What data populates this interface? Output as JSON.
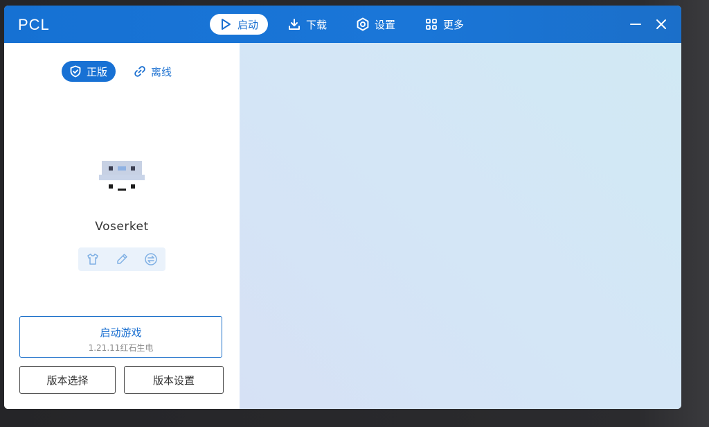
{
  "app": {
    "title": "PCL"
  },
  "nav": {
    "launch": "启动",
    "download": "下载",
    "settings": "设置",
    "more": "更多"
  },
  "auth": {
    "official": "正版",
    "offline": "离线"
  },
  "profile": {
    "username": "Voserket"
  },
  "actions": {
    "launch_title": "启动游戏",
    "launch_version": "1.21.11红石生电",
    "select_version": "版本选择",
    "version_settings": "版本设置"
  },
  "colors": {
    "accent": "#1871d4",
    "panel_bg": "#d6e4f5"
  }
}
